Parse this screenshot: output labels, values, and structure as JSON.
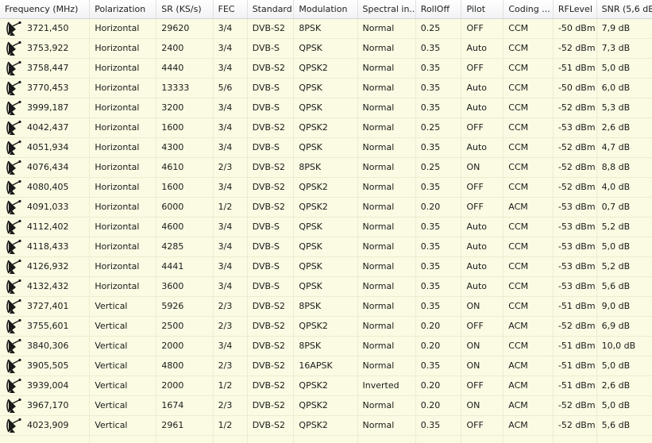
{
  "columns": [
    "Frequency (MHz)",
    "Polarization",
    "SR (KS/s)",
    "FEC",
    "Standard",
    "Modulation",
    "Spectral in...",
    "RollOff",
    "Pilot",
    "Coding ...",
    "RFLevel",
    "SNR (5,6 dB)"
  ],
  "row_icon": "satellite-dish-icon",
  "rows": [
    [
      "3721,450",
      "Horizontal",
      "29620",
      "3/4",
      "DVB-S2",
      "8PSK",
      "Normal",
      "0.25",
      "OFF",
      "CCM",
      "-50 dBm",
      "7,9 dB"
    ],
    [
      "3753,922",
      "Horizontal",
      "2400",
      "3/4",
      "DVB-S",
      "QPSK",
      "Normal",
      "0.35",
      "Auto",
      "CCM",
      "-52 dBm",
      "7,3 dB"
    ],
    [
      "3758,447",
      "Horizontal",
      "4440",
      "3/4",
      "DVB-S2",
      "QPSK2",
      "Normal",
      "0.35",
      "OFF",
      "CCM",
      "-51 dBm",
      "5,0 dB"
    ],
    [
      "3770,453",
      "Horizontal",
      "13333",
      "5/6",
      "DVB-S",
      "QPSK",
      "Normal",
      "0.35",
      "Auto",
      "CCM",
      "-50 dBm",
      "6,0 dB"
    ],
    [
      "3999,187",
      "Horizontal",
      "3200",
      "3/4",
      "DVB-S",
      "QPSK",
      "Normal",
      "0.35",
      "Auto",
      "CCM",
      "-52 dBm",
      "5,3 dB"
    ],
    [
      "4042,437",
      "Horizontal",
      "1600",
      "3/4",
      "DVB-S2",
      "QPSK2",
      "Normal",
      "0.25",
      "OFF",
      "CCM",
      "-53 dBm",
      "2,6 dB"
    ],
    [
      "4051,934",
      "Horizontal",
      "4300",
      "3/4",
      "DVB-S",
      "QPSK",
      "Normal",
      "0.35",
      "Auto",
      "CCM",
      "-52 dBm",
      "4,7 dB"
    ],
    [
      "4076,434",
      "Horizontal",
      "4610",
      "2/3",
      "DVB-S2",
      "8PSK",
      "Normal",
      "0.25",
      "ON",
      "CCM",
      "-52 dBm",
      "8,8 dB"
    ],
    [
      "4080,405",
      "Horizontal",
      "1600",
      "3/4",
      "DVB-S2",
      "QPSK2",
      "Normal",
      "0.35",
      "OFF",
      "CCM",
      "-52 dBm",
      "4,0 dB"
    ],
    [
      "4091,033",
      "Horizontal",
      "6000",
      "1/2",
      "DVB-S2",
      "QPSK2",
      "Normal",
      "0.20",
      "OFF",
      "ACM",
      "-53 dBm",
      "0,7 dB"
    ],
    [
      "4112,402",
      "Horizontal",
      "4600",
      "3/4",
      "DVB-S",
      "QPSK",
      "Normal",
      "0.35",
      "Auto",
      "CCM",
      "-53 dBm",
      "5,2 dB"
    ],
    [
      "4118,433",
      "Horizontal",
      "4285",
      "3/4",
      "DVB-S",
      "QPSK",
      "Normal",
      "0.35",
      "Auto",
      "CCM",
      "-53 dBm",
      "5,0 dB"
    ],
    [
      "4126,932",
      "Horizontal",
      "4441",
      "3/4",
      "DVB-S",
      "QPSK",
      "Normal",
      "0.35",
      "Auto",
      "CCM",
      "-53 dBm",
      "5,2 dB"
    ],
    [
      "4132,432",
      "Horizontal",
      "3600",
      "3/4",
      "DVB-S",
      "QPSK",
      "Normal",
      "0.35",
      "Auto",
      "CCM",
      "-53 dBm",
      "5,6 dB"
    ],
    [
      "3727,401",
      "Vertical",
      "5926",
      "2/3",
      "DVB-S2",
      "8PSK",
      "Normal",
      "0.35",
      "ON",
      "CCM",
      "-51 dBm",
      "9,0 dB"
    ],
    [
      "3755,601",
      "Vertical",
      "2500",
      "2/3",
      "DVB-S2",
      "QPSK2",
      "Normal",
      "0.20",
      "OFF",
      "ACM",
      "-52 dBm",
      "6,9 dB"
    ],
    [
      "3840,306",
      "Vertical",
      "2000",
      "3/4",
      "DVB-S2",
      "8PSK",
      "Normal",
      "0.20",
      "ON",
      "CCM",
      "-51 dBm",
      "10,0 dB"
    ],
    [
      "3905,505",
      "Vertical",
      "4800",
      "2/3",
      "DVB-S2",
      "16APSK",
      "Normal",
      "0.35",
      "ON",
      "ACM",
      "-51 dBm",
      "5,0 dB"
    ],
    [
      "3939,004",
      "Vertical",
      "2000",
      "1/2",
      "DVB-S2",
      "QPSK2",
      "Inverted",
      "0.20",
      "OFF",
      "ACM",
      "-51 dBm",
      "2,6 dB"
    ],
    [
      "3967,170",
      "Vertical",
      "1674",
      "2/3",
      "DVB-S2",
      "QPSK2",
      "Normal",
      "0.20",
      "ON",
      "ACM",
      "-52 dBm",
      "5,0 dB"
    ],
    [
      "4023,909",
      "Vertical",
      "2961",
      "1/2",
      "DVB-S2",
      "QPSK2",
      "Normal",
      "0.35",
      "OFF",
      "ACM",
      "-52 dBm",
      "5,6 dB"
    ]
  ],
  "colors": {
    "row_background": "#fbfbe3",
    "grid_line": "#ececd0",
    "header_background": "#f1f2f4",
    "icon": "#1a1a1a"
  }
}
